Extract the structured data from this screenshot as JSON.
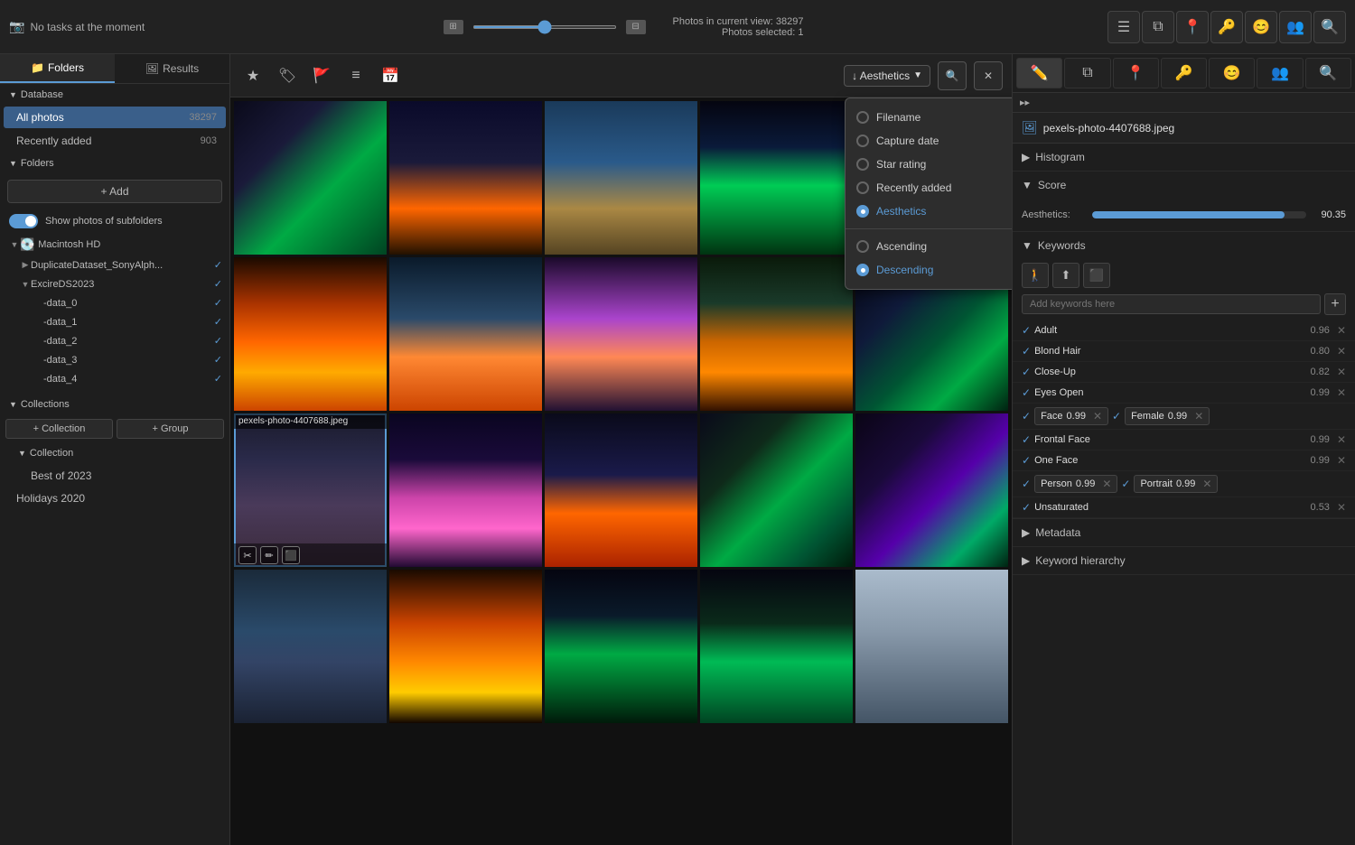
{
  "topbar": {
    "task_label": "No tasks at the moment",
    "photos_in_view": "Photos in current view: 38297",
    "photos_selected": "Photos selected: 1",
    "slider_value": 50
  },
  "sidebar": {
    "tabs": [
      {
        "id": "folders",
        "label": "Folders",
        "icon": "📁"
      },
      {
        "id": "results",
        "label": "Results",
        "icon": "🖼"
      }
    ],
    "database_label": "Database",
    "all_photos_label": "All photos",
    "all_photos_count": "38297",
    "recently_added_label": "Recently added",
    "recently_added_count": "903",
    "folders_label": "Folders",
    "add_button": "+ Add",
    "show_subfolders_label": "Show photos of subfolders",
    "macintosh_label": "Macintosh HD",
    "folders_tree": [
      {
        "name": "DuplicateDataset_SonyAlph...",
        "level": 1,
        "checked": true
      },
      {
        "name": "ExcireDS2023",
        "level": 1,
        "checked": true
      },
      {
        "name": "-data_0",
        "level": 2,
        "checked": true
      },
      {
        "name": "-data_1",
        "level": 2,
        "checked": true
      },
      {
        "name": "-data_2",
        "level": 2,
        "checked": true
      },
      {
        "name": "-data_3",
        "level": 2,
        "checked": true
      },
      {
        "name": "-data_4",
        "level": 2,
        "checked": true
      }
    ],
    "collections_label": "Collections",
    "collection_label": "Collection",
    "collection_btn": "+ Collection",
    "group_btn": "+ Group",
    "collections": [
      {
        "name": "Best of 2023"
      },
      {
        "name": "Holidays 2020"
      }
    ]
  },
  "toolbar": {
    "sort_label": "↓ Aesthetics",
    "sort_options": [
      {
        "id": "filename",
        "label": "Filename"
      },
      {
        "id": "capture_date",
        "label": "Capture date"
      },
      {
        "id": "star_rating",
        "label": "Star rating"
      },
      {
        "id": "recently_added",
        "label": "Recently added"
      },
      {
        "id": "aesthetics",
        "label": "Aesthetics",
        "selected": true
      }
    ],
    "order_options": [
      {
        "id": "ascending",
        "label": "Ascending"
      },
      {
        "id": "descending",
        "label": "Descending",
        "selected": true
      }
    ]
  },
  "photos": [
    {
      "id": 1,
      "class": "photo-aurora-1",
      "filename": ""
    },
    {
      "id": 2,
      "class": "photo-road",
      "filename": ""
    },
    {
      "id": 3,
      "class": "photo-mountain",
      "filename": ""
    },
    {
      "id": 4,
      "class": "photo-aurora-2",
      "filename": ""
    },
    {
      "id": 5,
      "class": "photo-aurora-3",
      "filename": ""
    },
    {
      "id": 6,
      "class": "photo-sunset-1",
      "filename": ""
    },
    {
      "id": 7,
      "class": "photo-boat-mountain",
      "filename": ""
    },
    {
      "id": 8,
      "class": "photo-lake-sunset",
      "filename": ""
    },
    {
      "id": 9,
      "class": "photo-boat-lake",
      "filename": ""
    },
    {
      "id": 10,
      "class": "photo-aurora-4",
      "filename": ""
    },
    {
      "id": 11,
      "class": "photo-woman",
      "filename": "pexels-photo-4407688.jpeg",
      "selected": true
    },
    {
      "id": 12,
      "class": "photo-aurora-pink",
      "filename": ""
    },
    {
      "id": 13,
      "class": "photo-dock",
      "filename": ""
    },
    {
      "id": 14,
      "class": "photo-aurora-5",
      "filename": ""
    },
    {
      "id": 15,
      "class": "photo-aurora-purple",
      "filename": ""
    },
    {
      "id": 16,
      "class": "photo-castle",
      "filename": ""
    },
    {
      "id": 17,
      "class": "photo-sunset-2",
      "filename": ""
    },
    {
      "id": 18,
      "class": "photo-path",
      "filename": ""
    },
    {
      "id": 19,
      "class": "photo-aurora-6",
      "filename": ""
    },
    {
      "id": 20,
      "class": "photo-mountain-person",
      "filename": ""
    }
  ],
  "right_panel": {
    "filename": "pexels-photo-4407688.jpeg",
    "expand_label": "▸▸",
    "histogram_label": "Histogram",
    "score_label": "Score",
    "aesthetics_label": "Aesthetics:",
    "aesthetics_value": "90.35",
    "aesthetics_percent": 90,
    "keywords_label": "Keywords",
    "add_keywords_placeholder": "Add keywords here",
    "keywords": [
      {
        "name": "Adult",
        "score": "0.96",
        "removable": true
      },
      {
        "name": "Blond Hair",
        "score": "0.80",
        "removable": true
      },
      {
        "name": "Close-Up",
        "score": "0.82",
        "removable": true
      },
      {
        "name": "Eyes Open",
        "score": "0.99",
        "removable": true
      },
      {
        "name": "Face",
        "score": "0.99",
        "removable": true,
        "inline": true
      },
      {
        "name": "Female",
        "score": "0.99",
        "removable": true,
        "inline": true
      },
      {
        "name": "Frontal Face",
        "score": "0.99",
        "removable": true
      },
      {
        "name": "One Face",
        "score": "0.99",
        "removable": true
      },
      {
        "name": "Person",
        "score": "0.99",
        "removable": true,
        "inline": true
      },
      {
        "name": "Portrait",
        "score": "0.99",
        "removable": true,
        "inline": true
      },
      {
        "name": "Unsaturated",
        "score": "0.53",
        "removable": true
      }
    ],
    "metadata_label": "Metadata",
    "keyword_hierarchy_label": "Keyword hierarchy"
  }
}
